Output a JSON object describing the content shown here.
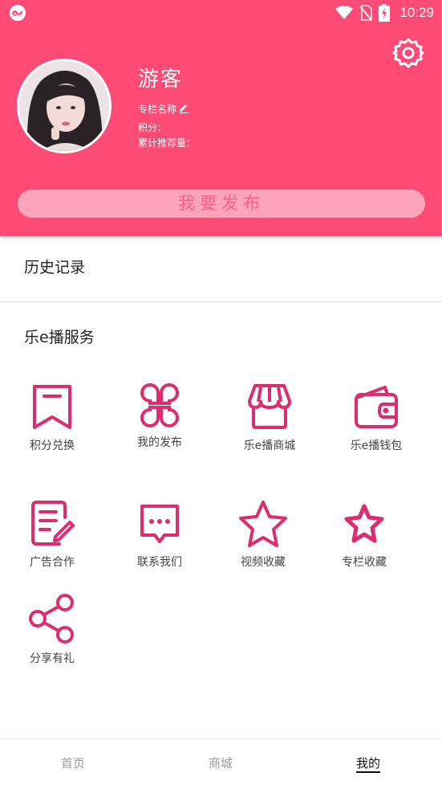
{
  "status_bar": {
    "time": "10:29",
    "icons": [
      "app-logo-icon",
      "wifi-icon",
      "no-sim-icon",
      "battery-charging-icon"
    ]
  },
  "profile": {
    "username": "游客",
    "column_name_label": "专栏名称",
    "points_label": "积分：",
    "recommend_label": "累计推荐量：",
    "publish_button": "我要发布"
  },
  "history": {
    "label": "历史记录"
  },
  "services": {
    "title": "乐e播服务",
    "items": [
      {
        "label": "积分兑换",
        "icon": "bookmark-icon"
      },
      {
        "label": "我的发布",
        "icon": "clover-grid-icon"
      },
      {
        "label": "乐e播商城",
        "icon": "store-icon"
      },
      {
        "label": "乐e播钱包",
        "icon": "wallet-icon"
      },
      {
        "label": "广告合作",
        "icon": "document-edit-icon"
      },
      {
        "label": "联系我们",
        "icon": "message-icon"
      },
      {
        "label": "视频收藏",
        "icon": "star-outline-icon"
      },
      {
        "label": "专栏收藏",
        "icon": "star-icon"
      },
      {
        "label": "分享有礼",
        "icon": "share-icon"
      }
    ]
  },
  "bottom_nav": {
    "items": [
      {
        "label": "首页",
        "active": false
      },
      {
        "label": "商城",
        "active": false
      },
      {
        "label": "我的",
        "active": true
      }
    ]
  },
  "colors": {
    "header": "#fd4b76",
    "accent_icon": "#dd2c6f",
    "publish_button_bg": "#fda4bb",
    "publish_button_text": "#fb5f85"
  }
}
